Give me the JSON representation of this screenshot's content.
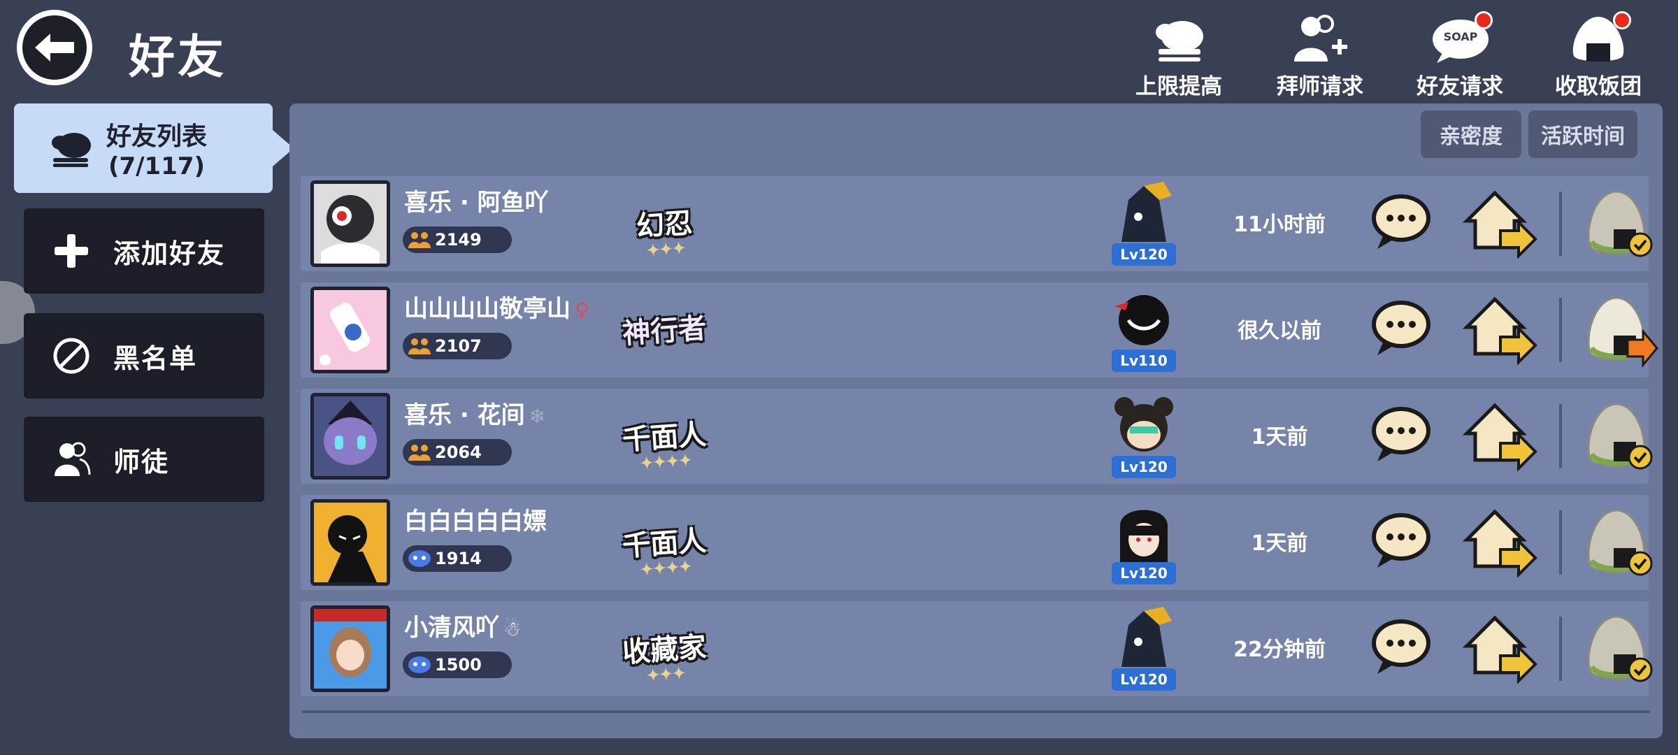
{
  "header": {
    "title": "好友",
    "actions": [
      {
        "label": "上限提高",
        "icon": "cloud-up-icon",
        "has_dot": false
      },
      {
        "label": "拜师请求",
        "icon": "add-master-icon",
        "has_dot": false
      },
      {
        "label": "好友请求",
        "icon": "soap-speech-icon",
        "icon_text": "SOAP",
        "has_dot": true
      },
      {
        "label": "收取饭团",
        "icon": "rice-ball-icon",
        "has_dot": true
      }
    ]
  },
  "sidebar": {
    "active": {
      "label": "好友列表",
      "count": "(7/117)"
    },
    "items": [
      {
        "label": "添加好友",
        "icon": "plus-icon"
      },
      {
        "label": "黑名单",
        "icon": "ban-icon"
      },
      {
        "label": "师徒",
        "icon": "master-apprentice-icon"
      }
    ]
  },
  "sort": {
    "intimacy": "亲密度",
    "active_time": "活跃时间"
  },
  "friends": [
    {
      "name": "喜乐 · 阿鱼吖",
      "name_icons": "",
      "power": "2149",
      "power_icon": "team-icon",
      "title": "幻忍",
      "level": "Lv120",
      "active": "11小时前",
      "gift_state": "collected"
    },
    {
      "name": "山山山山敬亭山",
      "name_icons": "♀",
      "power": "2107",
      "power_icon": "team-icon",
      "title": "神行者",
      "level": "Lv110",
      "active": "很久以前",
      "gift_state": "send"
    },
    {
      "name": "喜乐 · 花间",
      "name_icons": "❄",
      "power": "2064",
      "power_icon": "team-icon",
      "title": "千面人",
      "level": "Lv120",
      "active": "1天前",
      "gift_state": "collected"
    },
    {
      "name": "白白白白白嫖",
      "name_icons": "",
      "power": "1914",
      "power_icon": "mask-icon",
      "title": "千面人",
      "level": "Lv120",
      "active": "1天前",
      "gift_state": "collected"
    },
    {
      "name": "小清风吖",
      "name_icons": "☃",
      "power": "1500",
      "power_icon": "mask-icon",
      "title": "收藏家",
      "level": "Lv120",
      "active": "22分钟前",
      "gift_state": "collected"
    }
  ],
  "colors": {
    "bg": "#3a4053",
    "panel": "#6a7799",
    "row": "#7584a8",
    "accent": "#2e6fd6",
    "gold": "#f0c43a"
  }
}
